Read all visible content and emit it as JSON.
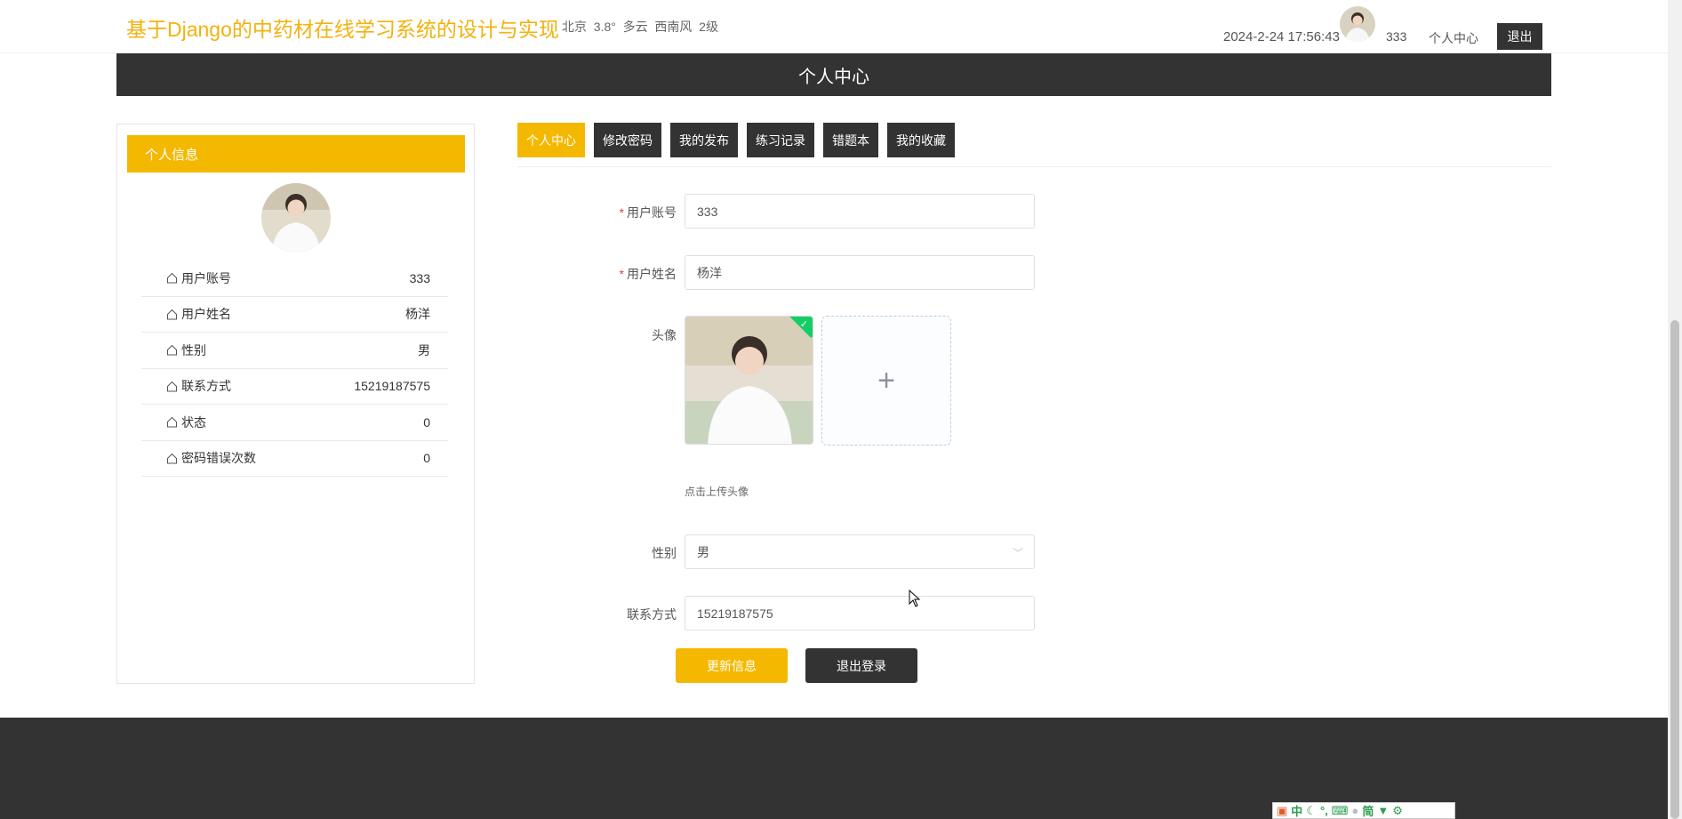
{
  "header": {
    "title": "基于Django的中药材在线学习系统的设计与实现",
    "weather": "北京  3.8°  多云  西南风  2级",
    "datetime": "2024-2-24 17:56:43",
    "username": "333",
    "center_link": "个人中心",
    "logout": "退出"
  },
  "banner": {
    "title": "个人中心"
  },
  "sidebar": {
    "header": "个人信息",
    "rows": [
      {
        "label": "用户账号",
        "value": "333"
      },
      {
        "label": "用户姓名",
        "value": "杨洋"
      },
      {
        "label": "性别",
        "value": "男"
      },
      {
        "label": "联系方式",
        "value": "15219187575"
      },
      {
        "label": "状态",
        "value": "0"
      },
      {
        "label": "密码错误次数",
        "value": "0"
      }
    ]
  },
  "tabs": [
    {
      "label": "个人中心",
      "active": true
    },
    {
      "label": "修改密码",
      "active": false
    },
    {
      "label": "我的发布",
      "active": false
    },
    {
      "label": "练习记录",
      "active": false
    },
    {
      "label": "错题本",
      "active": false
    },
    {
      "label": "我的收藏",
      "active": false
    }
  ],
  "form": {
    "account_label": "用户账号",
    "account_value": "333",
    "name_label": "用户姓名",
    "name_value": "杨洋",
    "avatar_label": "头像",
    "upload_tip": "点击上传头像",
    "gender_label": "性别",
    "gender_value": "男",
    "contact_label": "联系方式",
    "contact_value": "15219187575",
    "required_mark": "*"
  },
  "buttons": {
    "update": "更新信息",
    "logout": "退出登录"
  },
  "ime": {
    "items": [
      "中",
      "简"
    ]
  },
  "colors": {
    "accent": "#f5b800",
    "dark": "#333333",
    "title": "#f2b20e"
  }
}
